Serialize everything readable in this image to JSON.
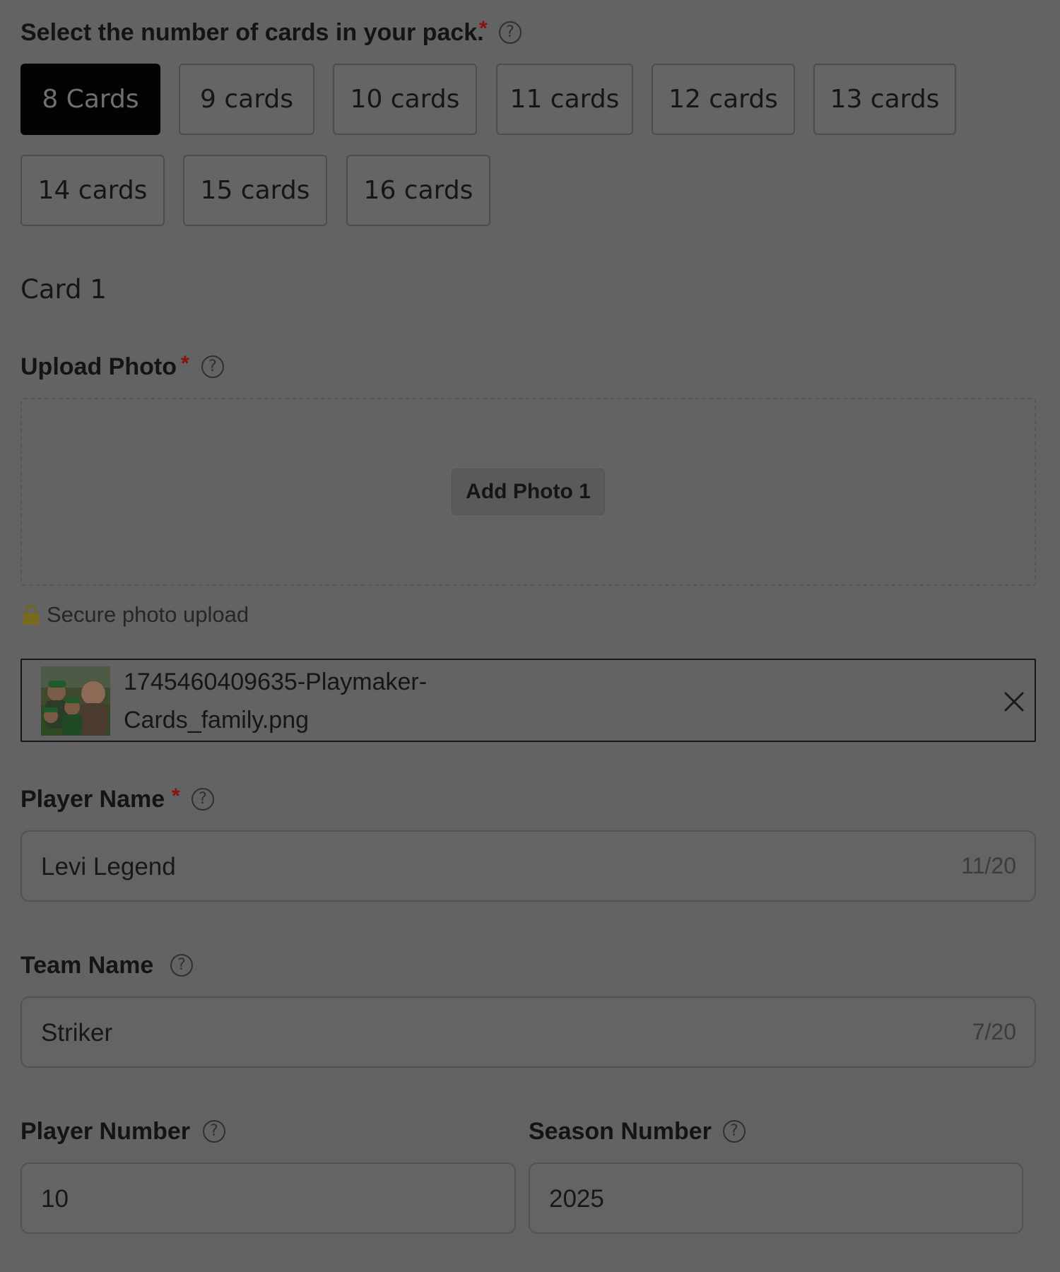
{
  "pack": {
    "label": "Select the number of cards in your pack.",
    "required_mark": "*",
    "help_icon": "?",
    "options": [
      "8 Cards",
      "9 cards",
      "10 cards",
      "11 cards",
      "12 cards",
      "13 cards",
      "14 cards",
      "15 cards",
      "16 cards"
    ],
    "selected": "8 Cards"
  },
  "card": {
    "title": "Card 1",
    "upload": {
      "label": "Upload Photo",
      "required_mark": "*",
      "help_icon": "?",
      "button": "Add Photo 1",
      "secure_text": "Secure photo upload",
      "lock_icon": "lock-icon"
    },
    "file": {
      "name_line1": "1745460409635-Playmaker-",
      "name_line2": "Cards_family.png",
      "remove_icon": "close-icon"
    },
    "player_name": {
      "label": "Player Name",
      "required_mark": "*",
      "help_icon": "?",
      "value": "Levi Legend",
      "counter": "11/20"
    },
    "team_name": {
      "label": "Team Name",
      "help_icon": "?",
      "value": "Striker",
      "counter": "7/20"
    },
    "player_number": {
      "label": "Player Number",
      "help_icon": "?",
      "value": "10"
    },
    "season_number": {
      "label": "Season Number",
      "help_icon": "?",
      "value": "2025"
    }
  },
  "colors": {
    "overlay_background": "#636363",
    "selected_option": "#030303",
    "required": "#8a1111"
  }
}
